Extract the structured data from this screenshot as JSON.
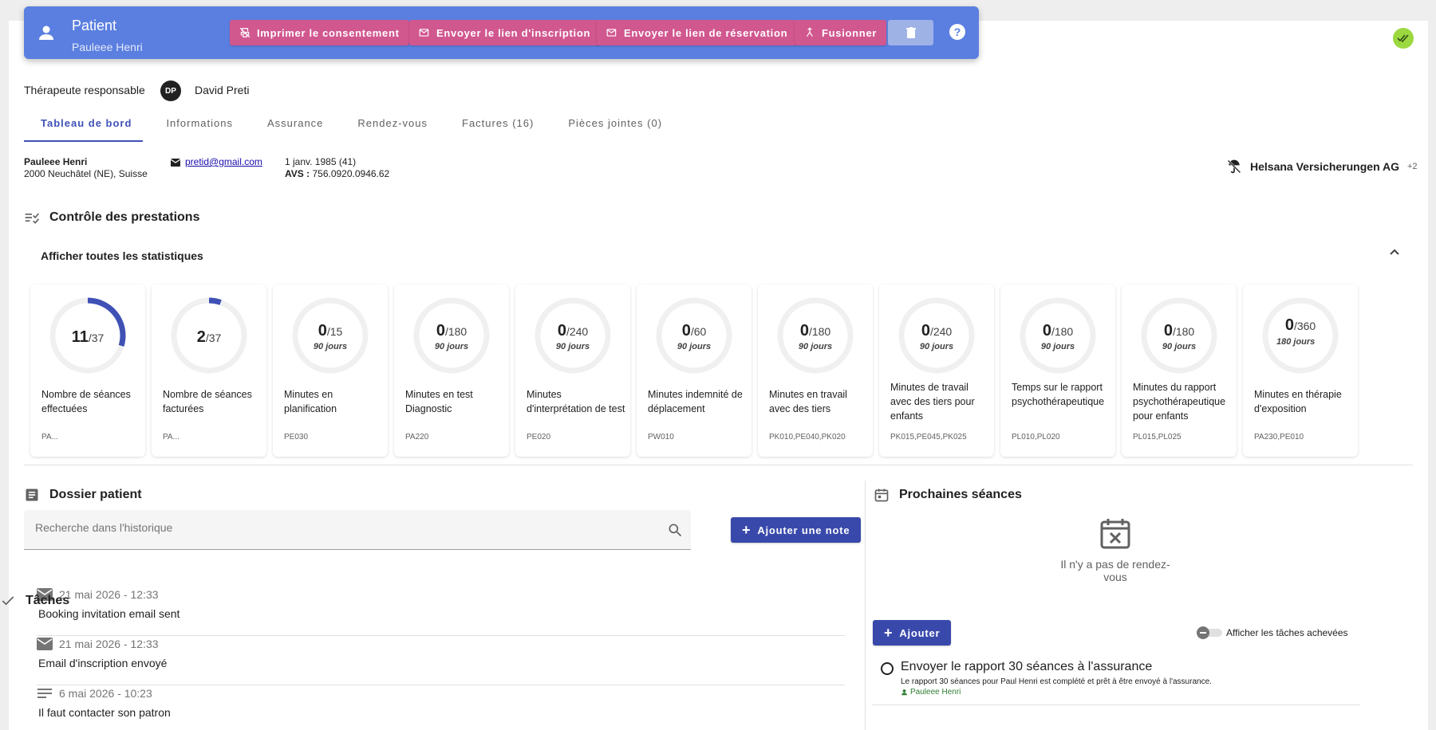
{
  "header": {
    "title": "Patient",
    "subtitle": "Pauleee Henri",
    "buttons": {
      "consent": "Imprimer le consentement",
      "registration_link": "Envoyer le lien d'inscription",
      "booking_link": "Envoyer le lien de réservation",
      "merge": "Fusionner"
    },
    "help": "?",
    "colors": {
      "bar": "#5b7fe0",
      "action": "#d1578f",
      "sync": "#9cd83f"
    }
  },
  "therapist": {
    "label": "Thérapeute responsable",
    "initials": "DP",
    "name": "David Preti"
  },
  "tabs": [
    {
      "label": "Tableau de bord",
      "active": true
    },
    {
      "label": "Informations"
    },
    {
      "label": "Assurance"
    },
    {
      "label": "Rendez-vous"
    },
    {
      "label": "Factures (16)"
    },
    {
      "label": "Pièces jointes (0)"
    }
  ],
  "patient": {
    "name": "Pauleee Henri",
    "address": "2000 Neuchâtel (NE), Suisse",
    "email": "pretid@gmail.com",
    "birth": "1 janv. 1985 (41)",
    "avs_label": "AVS :",
    "avs": "756.0920.0946.62"
  },
  "insurer": {
    "name": "Helsana Versicherungen AG",
    "more": "+2"
  },
  "controls": {
    "title": "Contrôle des prestations",
    "toggle": "Afficher toutes les statistiques",
    "stats": [
      {
        "value": "11",
        "max": "/37",
        "period": "",
        "label": "Nombre de séances effectuées",
        "code": "PA...",
        "fraction": 0.297
      },
      {
        "value": "2",
        "max": "/37",
        "period": "",
        "label": "Nombre de séances facturées",
        "code": "PA...",
        "fraction": 0.054
      },
      {
        "value": "0",
        "max": "/15",
        "period": "90 jours",
        "label": "Minutes en planification",
        "code": "PE030",
        "fraction": 0
      },
      {
        "value": "0",
        "max": "/180",
        "period": "90 jours",
        "label": "Minutes en test Diagnostic",
        "code": "PA220",
        "fraction": 0
      },
      {
        "value": "0",
        "max": "/240",
        "period": "90 jours",
        "label": "Minutes d'interprétation de test",
        "code": "PE020",
        "fraction": 0
      },
      {
        "value": "0",
        "max": "/60",
        "period": "90 jours",
        "label": "Minutes indemnité de déplacement",
        "code": "PW010",
        "fraction": 0
      },
      {
        "value": "0",
        "max": "/180",
        "period": "90 jours",
        "label": "Minutes en travail avec des tiers",
        "code": "PK010,PE040,PK020",
        "fraction": 0
      },
      {
        "value": "0",
        "max": "/240",
        "period": "90 jours",
        "label": "Minutes de travail avec des tiers pour enfants",
        "code": "PK015,PE045,PK025",
        "fraction": 0
      },
      {
        "value": "0",
        "max": "/180",
        "period": "90 jours",
        "label": "Temps sur le rapport psychothérapeutique",
        "code": "PL010,PL020",
        "fraction": 0
      },
      {
        "value": "0",
        "max": "/180",
        "period": "90 jours",
        "label": "Minutes du rapport psychothérapeutique pour enfants",
        "code": "PL015,PL025",
        "fraction": 0
      },
      {
        "value": "0",
        "max": "/360",
        "period": "180 jours",
        "label": "Minutes en thérapie d'exposition",
        "code": "PA230,PE010",
        "fraction": 0
      }
    ]
  },
  "dossier": {
    "title": "Dossier patient",
    "search_placeholder": "Recherche dans l'historique",
    "add_note": "Ajouter une note",
    "history": [
      {
        "icon": "mail-icon",
        "date": "21 mai 2026 - 12:33",
        "text": "Booking invitation email sent"
      },
      {
        "icon": "mail-icon",
        "date": "21 mai 2026 - 12:33",
        "text": "Email d'inscription envoyé"
      },
      {
        "icon": "note-icon",
        "date": "6 mai 2026 - 10:23",
        "text": "Il faut contacter son patron"
      }
    ]
  },
  "sessions": {
    "title": "Prochaines séances",
    "empty": "Il n'y a pas de rendez-vous"
  },
  "tasks": {
    "title": "Tâches",
    "add": "Ajouter",
    "show_done": "Afficher les tâches achevées",
    "items": [
      {
        "title": "Envoyer le rapport 30 séances à l'assurance",
        "desc": "Le rapport 30 séances pour Paul Henri est complété et prêt à être envoyé à l'assurance.",
        "patient": "Pauleee Henri"
      }
    ]
  }
}
